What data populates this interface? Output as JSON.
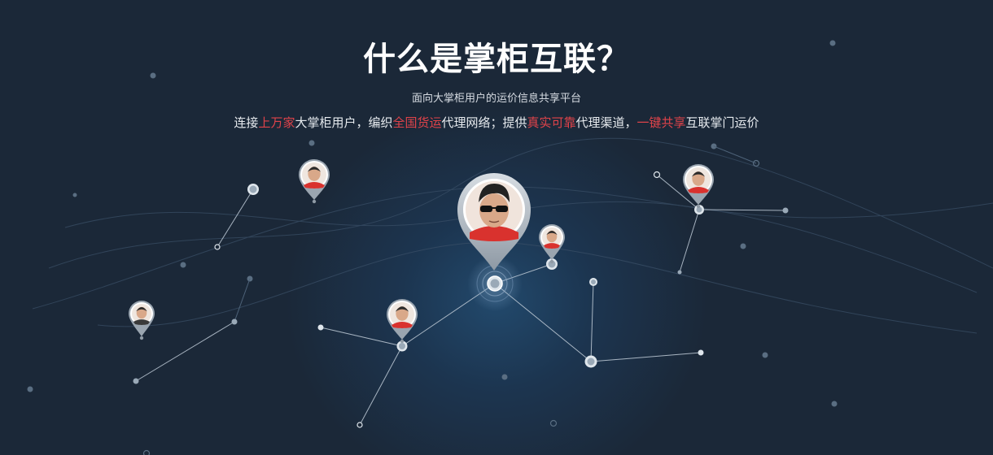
{
  "header": {
    "title": "什么是掌柜互联？",
    "subtitle": "面向大掌柜用户的运价信息共享平台"
  },
  "tagline": {
    "p1": "连接",
    "h1": "上万家",
    "p2": "大掌柜用户，编织",
    "h2": "全国货运",
    "p3": "代理网络；提供",
    "h3": "真实可靠",
    "p4": "代理渠道，",
    "h4": "一键共享",
    "p5": "互联掌门运价"
  },
  "colors": {
    "background": "#1b2838",
    "highlight": "#e0434a",
    "text": "#ffffff",
    "node": "#c9d3dd"
  },
  "icons": {
    "avatar_pin": "map-pin-avatar-icon",
    "network_node": "network-node-icon"
  }
}
